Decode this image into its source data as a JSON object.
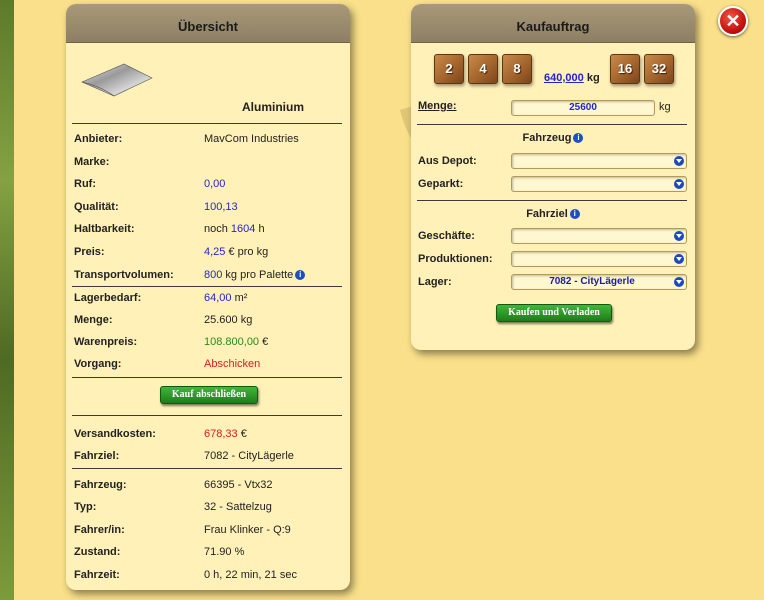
{
  "close_label": "✕",
  "overview": {
    "title": "Übersicht",
    "product_name": "Aluminium",
    "rows1": [
      {
        "label": "Anbieter:",
        "value": "MavCom Industries",
        "unit": "",
        "color": ""
      },
      {
        "label": "Marke:",
        "value": "",
        "unit": "",
        "color": ""
      },
      {
        "label": "Ruf:",
        "value": "0,00",
        "unit": "",
        "color": "blue"
      },
      {
        "label": "Qualität:",
        "value": "100,13",
        "unit": "",
        "color": "blue"
      },
      {
        "label": "Haltbarkeit:",
        "prefix": "noch ",
        "value": "1604",
        "unit": " h",
        "color": "blue"
      },
      {
        "label": "Preis:",
        "value": "4,25",
        "unit": " € pro kg",
        "color": "blue"
      },
      {
        "label": "Transportvolumen:",
        "value": "800",
        "unit": " kg pro Palette",
        "color": "blue"
      }
    ],
    "rows2": [
      {
        "label": "Lagerbedarf:",
        "value": "64,00",
        "unit": " m²",
        "color": "blue"
      },
      {
        "label": "Menge:",
        "value": "25.600 kg",
        "unit": "",
        "color": ""
      },
      {
        "label": "Warenpreis:",
        "value": "108.800,00",
        "unit": " €",
        "color": "green"
      },
      {
        "label": "Vorgang:",
        "value": "Abschicken",
        "unit": "",
        "color": "red"
      }
    ],
    "button_label": "Kauf abschließen",
    "rows3": [
      {
        "label": "Versandkosten:",
        "value": "678,33",
        "unit": " €",
        "color": "red"
      },
      {
        "label": "Fahrziel:",
        "value": "7082 - CityLägerle",
        "unit": "",
        "color": ""
      }
    ],
    "rows4": [
      {
        "label": "Fahrzeug:",
        "value": "66395 - Vtx32"
      },
      {
        "label": "Typ:",
        "value": "32 - Sattelzug"
      },
      {
        "label": "Fahrer/in:",
        "value": "Frau Klinker - Q:9"
      },
      {
        "label": "Zustand:",
        "value": "71.90 %"
      },
      {
        "label": "Fahrzeit:",
        "value": "0 h, 22 min, 21 sec"
      }
    ]
  },
  "purchase": {
    "title": "Kaufauftrag",
    "crates": [
      "2",
      "4",
      "8",
      "16",
      "32"
    ],
    "capacity_value": "640,000",
    "capacity_unit": "kg",
    "menge_label": "Menge:",
    "menge_value": "25600",
    "menge_unit": "kg",
    "fahrzeug_title": "Fahrzeug",
    "aus_depot_label": "Aus Depot:",
    "geparkt_label": "Geparkt:",
    "fahrziel_title": "Fahrziel",
    "geschaefte_label": "Geschäfte:",
    "produktionen_label": "Produktionen:",
    "lager_label": "Lager:",
    "lager_value": "7082 - CityLägerle",
    "button_label": "Kaufen und Verladen"
  }
}
